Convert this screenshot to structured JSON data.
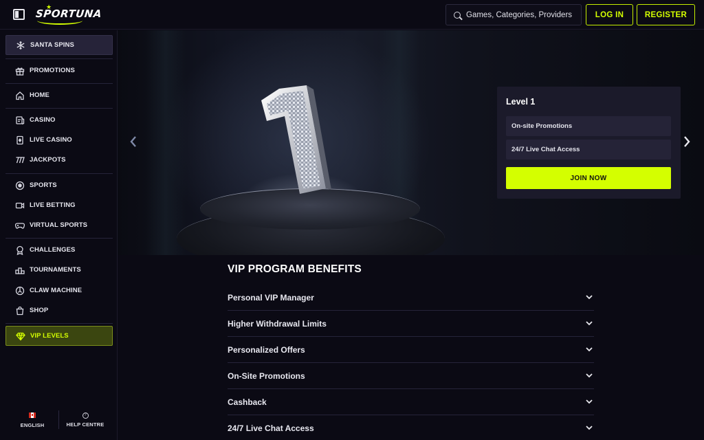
{
  "header": {
    "logo_text": "SPORTUNA",
    "search_placeholder": "Games, Categories, Providers",
    "login_label": "LOG IN",
    "register_label": "REGISTER"
  },
  "sidebar": {
    "items": [
      {
        "label": "SANTA SPINS",
        "icon": "snowflake-icon"
      },
      {
        "label": "PROMOTIONS",
        "icon": "gift-icon"
      },
      {
        "label": "HOME",
        "icon": "home-icon"
      },
      {
        "label": "CASINO",
        "icon": "casino-icon"
      },
      {
        "label": "LIVE CASINO",
        "icon": "live-casino-icon"
      },
      {
        "label": "JACKPOTS",
        "icon": "jackpot-icon"
      },
      {
        "label": "SPORTS",
        "icon": "soccer-ball-icon"
      },
      {
        "label": "LIVE BETTING",
        "icon": "live-betting-icon"
      },
      {
        "label": "VIRTUAL SPORTS",
        "icon": "gamepad-icon"
      },
      {
        "label": "CHALLENGES",
        "icon": "medal-icon"
      },
      {
        "label": "TOURNAMENTS",
        "icon": "podium-icon"
      },
      {
        "label": "CLAW MACHINE",
        "icon": "claw-icon"
      },
      {
        "label": "SHOP",
        "icon": "shopping-bag-icon"
      },
      {
        "label": "VIP LEVELS",
        "icon": "diamond-icon"
      }
    ],
    "footer": {
      "language": "ENGLISH",
      "help": "HELP CENTRE"
    }
  },
  "hero": {
    "level_card": {
      "title": "Level 1",
      "features": [
        "On-site Promotions",
        "24/7 Live Chat Access"
      ],
      "cta": "JOIN NOW"
    }
  },
  "vip": {
    "title": "VIP PROGRAM BENEFITS",
    "benefits": [
      "Personal VIP Manager",
      "Higher Withdrawal Limits",
      "Personalized Offers",
      "On-Site Promotions",
      "Cashback",
      "24/7 Live Chat Access"
    ]
  },
  "colors": {
    "accent": "#d4ff00",
    "background": "#0b0a14",
    "card": "#1b1a2a"
  }
}
